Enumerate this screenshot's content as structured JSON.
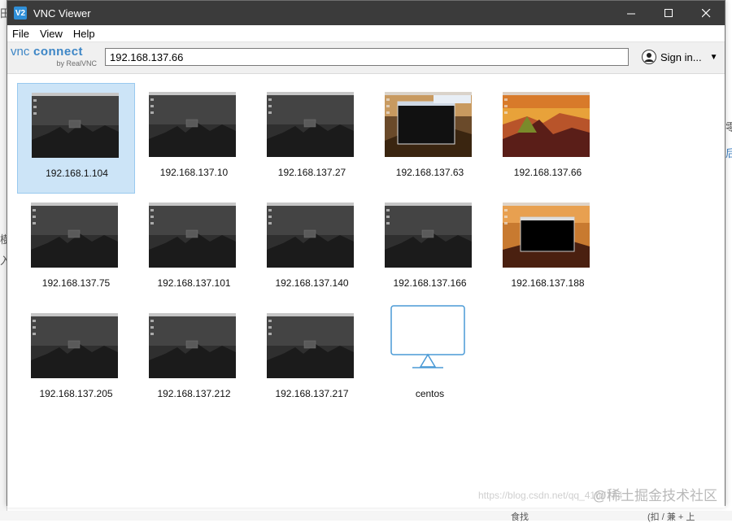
{
  "window": {
    "title": "VNC Viewer",
    "logo_text": "V2",
    "controls": {
      "minimize": "—",
      "maximize": "☐",
      "close": "✕"
    }
  },
  "menu": [
    {
      "label": "File"
    },
    {
      "label": "View"
    },
    {
      "label": "Help"
    }
  ],
  "toolbar": {
    "brand_prefix": "vnc",
    "brand_main": "connect",
    "brand_sub": "by RealVNC",
    "address_value": "192.168.137.66",
    "signin_label": "Sign in...",
    "signin_caret": "▼"
  },
  "connections": [
    {
      "label": "192.168.1.104",
      "thumb": "dark",
      "selected": true
    },
    {
      "label": "192.168.137.10",
      "thumb": "dark"
    },
    {
      "label": "192.168.137.27",
      "thumb": "dark"
    },
    {
      "label": "192.168.137.63",
      "thumb": "terminal"
    },
    {
      "label": "192.168.137.66",
      "thumb": "sunset"
    },
    {
      "label": "192.168.137.75",
      "thumb": "dark"
    },
    {
      "label": "192.168.137.101",
      "thumb": "dark"
    },
    {
      "label": "192.168.137.140",
      "thumb": "dark"
    },
    {
      "label": "192.168.137.166",
      "thumb": "dark"
    },
    {
      "label": "192.168.137.188",
      "thumb": "sunset-term"
    },
    {
      "label": "192.168.137.205",
      "thumb": "dark"
    },
    {
      "label": "192.168.137.212",
      "thumb": "dark"
    },
    {
      "label": "192.168.137.217",
      "thumb": "dark"
    },
    {
      "label": "centos",
      "thumb": "monitor"
    }
  ],
  "watermark": {
    "text": "@稀土掘金技术社区",
    "url_text": "https://blog.csdn.net/qq_4107774"
  },
  "background_glyphs": {
    "left_1": "田",
    "left_2": "樹",
    "left_3": "入",
    "right_1": "零",
    "right_2": "后",
    "bottom_1": "食找",
    "bottom_2": "(扣 / 兼 + 上"
  },
  "colors": {
    "titlebar": "#3b3b3b",
    "selection": "#cce4f7",
    "brand": "#3d86c6",
    "monitor_icon": "#4a9ad6"
  }
}
